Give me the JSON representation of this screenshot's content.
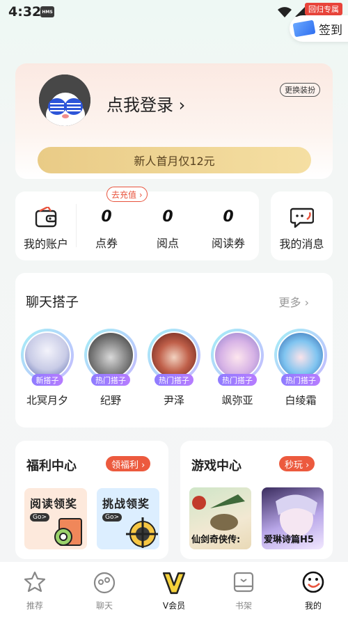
{
  "status_bar": {
    "time": "4:32",
    "badge": "HMS",
    "vip_ribbon": "回归专属"
  },
  "checkin": {
    "label": "签到"
  },
  "profile": {
    "login_text": "点我登录 ›",
    "dress_button": "更换装扮",
    "promo": "新人首月仅12元"
  },
  "account": {
    "wallet_label": "我的账户",
    "recharge_tag": "去充值 ›",
    "items": [
      {
        "value": "0",
        "label": "点券"
      },
      {
        "value": "0",
        "label": "阅点"
      },
      {
        "value": "0",
        "label": "阅读券"
      }
    ],
    "messages_label": "我的消息"
  },
  "chat": {
    "title": "聊天搭子",
    "more": "更多 ›",
    "partners": [
      {
        "tag": "新搭子",
        "name": "北冥月夕"
      },
      {
        "tag": "热门搭子",
        "name": "纪野"
      },
      {
        "tag": "热门搭子",
        "name": "尹泽"
      },
      {
        "tag": "热门搭子",
        "name": "飒弥亚"
      },
      {
        "tag": "热门搭子",
        "name": "白绫霜"
      }
    ]
  },
  "welfare": {
    "title": "福利中心",
    "button": "领福利 ›",
    "tiles": [
      {
        "text": "阅读领奖",
        "go": "Go>"
      },
      {
        "text": "挑战领奖",
        "go": "Go>"
      }
    ]
  },
  "games": {
    "title": "游戏中心",
    "button": "秒玩 ›",
    "tiles": [
      {
        "name": "仙剑奇侠传:"
      },
      {
        "name": "爱琳诗篇H5"
      }
    ]
  },
  "tabbar": {
    "tabs": [
      {
        "label": "推荐",
        "icon": "star-icon"
      },
      {
        "label": "聊天",
        "icon": "chat-face-icon"
      },
      {
        "label": "V会员",
        "icon": "vip-icon"
      },
      {
        "label": "书架",
        "icon": "bookshelf-icon"
      },
      {
        "label": "我的",
        "icon": "profile-face-icon"
      }
    ],
    "active": "我的"
  }
}
